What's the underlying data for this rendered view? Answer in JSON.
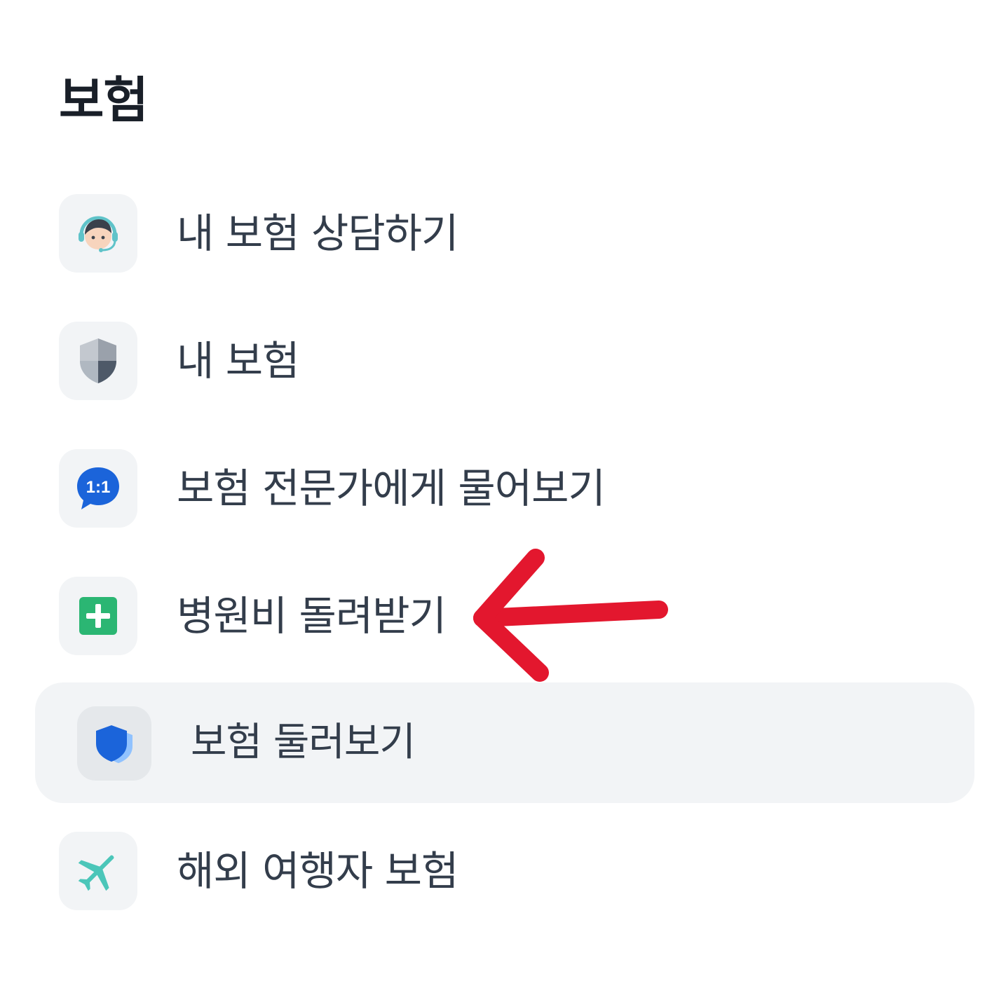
{
  "section": {
    "title": "보험"
  },
  "menu": {
    "items": [
      {
        "label": "내 보험 상담하기",
        "icon": "counselor-headset-icon"
      },
      {
        "label": "내 보험",
        "icon": "shield-icon"
      },
      {
        "label": "보험 전문가에게 물어보기",
        "icon": "one-to-one-chat-icon",
        "icon_text": "1:1"
      },
      {
        "label": "병원비 돌려받기",
        "icon": "hospital-cross-icon"
      },
      {
        "label": "보험 둘러보기",
        "icon": "blue-shield-icon",
        "highlighted": true
      },
      {
        "label": "해외 여행자 보험",
        "icon": "airplane-icon"
      }
    ]
  },
  "annotation": {
    "arrow_color": "#e3172e",
    "points_to": "병원비 돌려받기"
  },
  "colors": {
    "title": "#191f28",
    "label": "#333d4b",
    "icon_bg": "#f2f4f6",
    "highlight_bg": "#f2f4f6",
    "chat_blue": "#1b64da",
    "green": "#2bb673",
    "teal": "#4bc6b9"
  }
}
